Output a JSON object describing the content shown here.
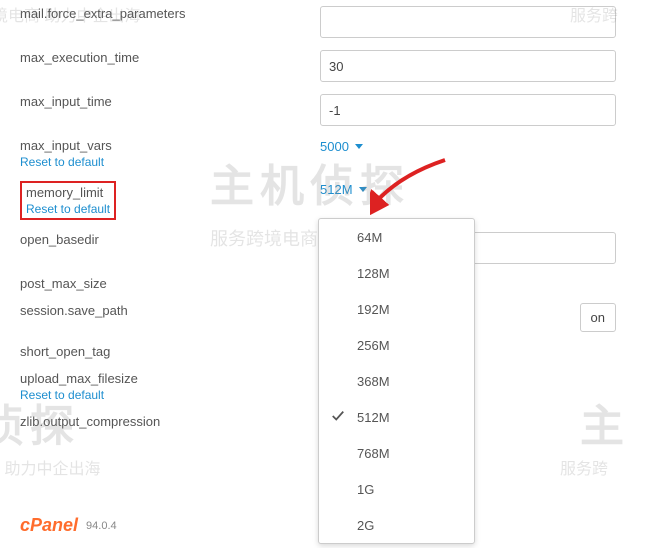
{
  "rows": [
    {
      "label": "mail.force_extra_parameters",
      "type": "text",
      "value": ""
    },
    {
      "label": "max_execution_time",
      "type": "text",
      "value": "30"
    },
    {
      "label": "max_input_time",
      "type": "text",
      "value": "-1"
    },
    {
      "label": "max_input_vars",
      "type": "dropdown",
      "value": "5000",
      "reset": "Reset to default"
    },
    {
      "label": "memory_limit",
      "type": "dropdown",
      "value": "512M",
      "reset": "Reset to default",
      "highlight": true
    },
    {
      "label": "open_basedir",
      "type": "text",
      "value": ""
    },
    {
      "label": "post_max_size",
      "type": "dropdown",
      "value": ""
    },
    {
      "label": "session.save_path",
      "type": "text-partial",
      "value": ""
    },
    {
      "label": "short_open_tag",
      "type": "dropdown",
      "value": ""
    },
    {
      "label": "upload_max_filesize",
      "type": "dropdown",
      "value": "",
      "reset": "Reset to default"
    },
    {
      "label": "zlib.output_compression",
      "type": "dropdown",
      "value": ""
    }
  ],
  "dropdown_menu": {
    "options": [
      "64M",
      "128M",
      "192M",
      "256M",
      "368M",
      "512M",
      "768M",
      "1G",
      "2G"
    ],
    "selected": "512M"
  },
  "footer": {
    "brand": "cPanel",
    "version": "94.0.4"
  },
  "partial_button_text": "on",
  "watermarks": {
    "a": "服务跨境电商 助力中企出海",
    "b": "主机侦探",
    "c": "务跨境电商 助力中企出海",
    "d": "服务跨"
  }
}
